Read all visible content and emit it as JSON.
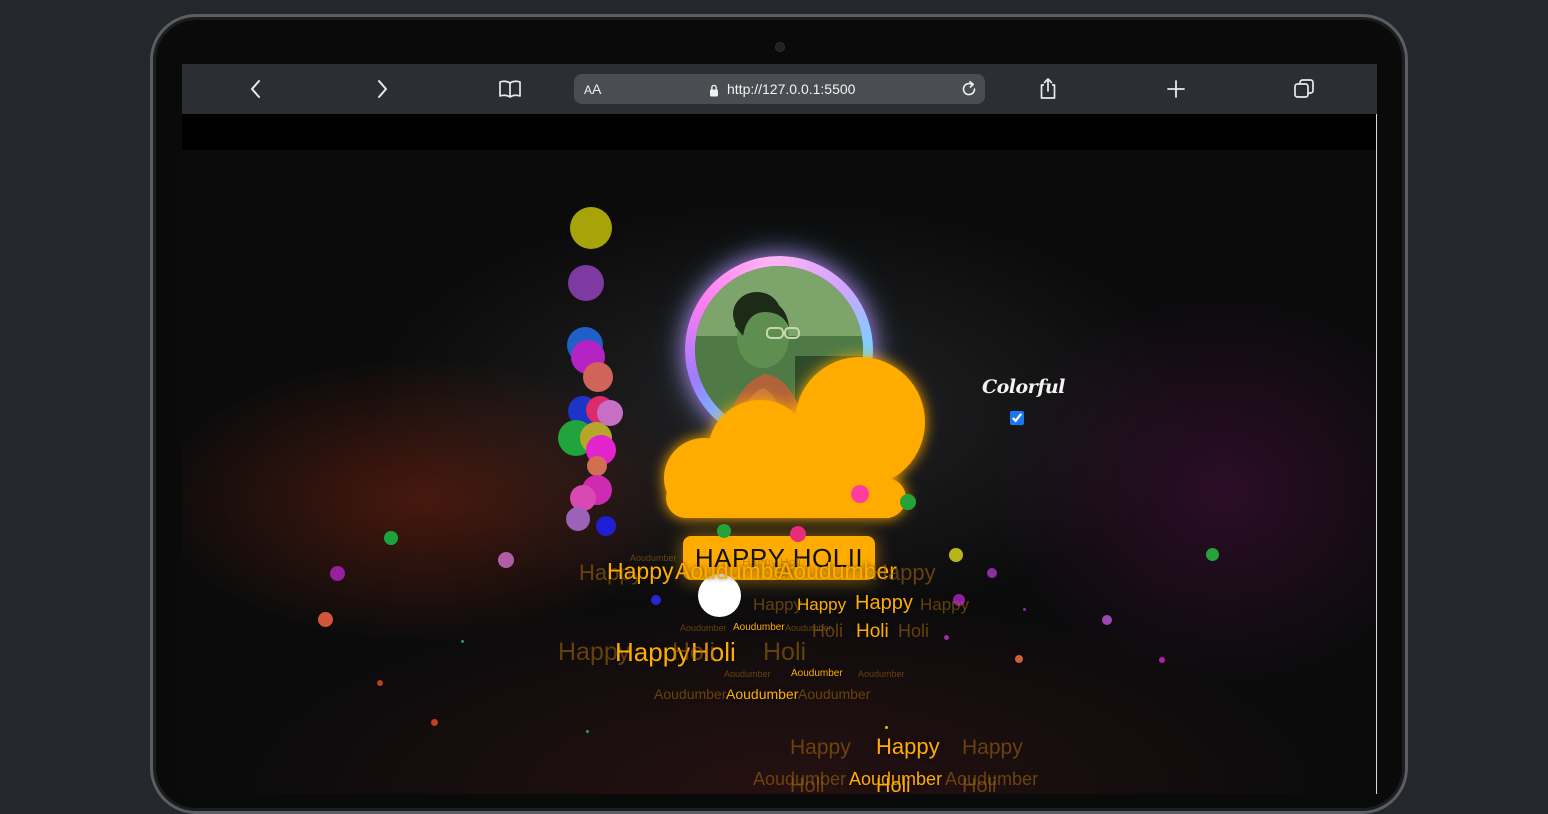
{
  "browser": {
    "url_prefix_small": "A",
    "url_prefix_big": "A",
    "url": "http://127.0.0.1:5500",
    "icons": [
      "back-icon",
      "forward-icon",
      "book-icon",
      "lock-icon",
      "reload-icon",
      "share-icon",
      "plus-icon",
      "tabs-icon"
    ]
  },
  "page": {
    "badge_text": "HAPPY HOLII",
    "toggle_label": "Colorful",
    "toggle_checked": true,
    "texts": {
      "t1a": "Happy",
      "t1b": "Aoudumber",
      "t1c": "Happy",
      "t1d": "Aoudumber",
      "t2": "Happy",
      "t2b": "Happy",
      "t3": "Holi",
      "t3b": "Holi",
      "t4": "Aoudumber",
      "t4b": "Aoudumber",
      "t5": "Happy",
      "t5b": "Holi",
      "t6": "Aoudumber",
      "t6b": "Aoudumber",
      "t7": "Aoudumber",
      "t7b": "Aoudumber",
      "t8": "Happy",
      "t8b": "Happy",
      "t8c": "Happy",
      "t9": "Aoudumber",
      "t9b": "Aoudumber",
      "t9c": "Aoudumber",
      "t9d": "Holi",
      "t9e": "Holi",
      "top_faded_1": "Aoudumber",
      "top_faded_2": "Happy Holi"
    },
    "colors": {
      "accent": "#ffab00",
      "checkbox": "#1877f2",
      "background": "#000000"
    }
  }
}
